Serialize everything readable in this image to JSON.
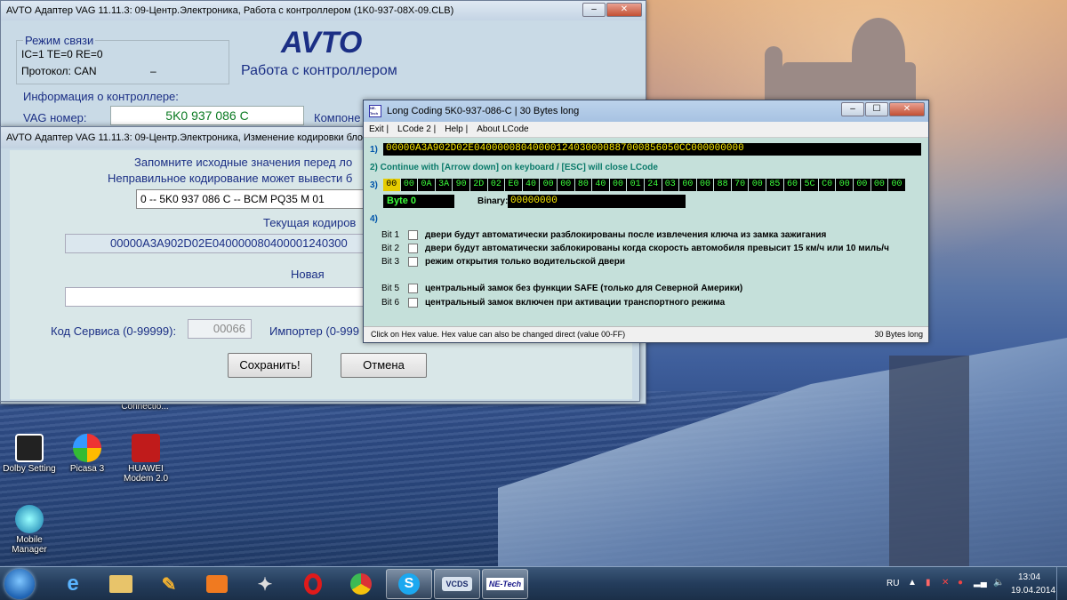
{
  "main_window": {
    "title": "AVTO Адаптер VAG 11.11.3: 09-Центр.Электроника,  Работа с контроллером (1K0-937-08X-09.CLB)",
    "comm_mode_label": "Режим связи",
    "comm_values": "IC=1  TE=0   RE=0",
    "protocol": "Протокол: CAN",
    "protocol_dash": "–",
    "logo": "AVTO",
    "subtitle": "Работа с контроллером",
    "controller_info_label": "Информация о контроллере:",
    "vag_label": "VAG номер:",
    "vag_value": "5K0 937 086 C",
    "component_label": "Компоне"
  },
  "coding_window": {
    "title": "AVTO Адаптер VAG 11.11.3: 09-Центр.Электроника,  Изменение кодировки блока",
    "warning_line1": "Запомните исходные значения перед ло",
    "warning_line2": "Неправильное кодирование может вывести б",
    "dropdown_value": "0 -- 5K0 937 086 C -- BCM PQ35 M    01",
    "current_label": "Текущая кодиров",
    "current_value": "00000A3A902D02E040000080400001240300",
    "new_label": "Новая",
    "new_value": "",
    "service_label": "Код Сервиса (0-99999):",
    "service_value": "00066",
    "importer_label": "Импортер (0-999",
    "save_button": "Сохранить!",
    "cancel_button": "Отмена"
  },
  "long_coding": {
    "title": "Long Coding  5K0-937-086-C | 30 Bytes long",
    "app_icon": "NE-Tech",
    "menu": [
      "Exit |",
      "LCode 2 |",
      "Help |",
      "About LCode"
    ],
    "step1": "1)",
    "coding_string": "00000A3A902D02E04000008040000124030000887000856050CC000000000",
    "step2": "2) Continue with [Arrow down] on keyboard / [ESC] will close LCode",
    "step3": "3)",
    "bytes": [
      "00",
      "00",
      "0A",
      "3A",
      "90",
      "2D",
      "02",
      "E0",
      "40",
      "00",
      "00",
      "80",
      "40",
      "00",
      "01",
      "24",
      "03",
      "00",
      "00",
      "88",
      "70",
      "00",
      "85",
      "60",
      "5C",
      "C0",
      "00",
      "00",
      "00",
      "00"
    ],
    "selected_byte_index": 0,
    "byte_label": "Byte 0",
    "binary_label": "Binary:",
    "binary_value": "00000000",
    "step4": "4)",
    "bits": [
      {
        "label": "Bit 1",
        "text": "двери будут автоматически разблокированы после извлечения ключа из замка зажигания",
        "checked": false
      },
      {
        "label": "Bit 2",
        "text": "двери будут автоматически заблокированы когда скорость автомобиля превысит 15 км/ч или 10 миль/ч",
        "checked": false
      },
      {
        "label": "Bit 3",
        "text": "режим открытия только водительской двери",
        "checked": false
      },
      {
        "label": "Bit 5",
        "text": "центральный замок без функции SAFE (только для Северной Америки)",
        "checked": false
      },
      {
        "label": "Bit 6",
        "text": "центральный замок включен при активации транспортного режима",
        "checked": false
      }
    ],
    "status_left": "Click on Hex value. Hex value can also be changed direct (value 00-FF)",
    "status_right": "30 Bytes long"
  },
  "desktop_icons": [
    {
      "label": "Connectio...",
      "icon": "network-icon"
    },
    {
      "label": "Dolby Setting",
      "icon": "dolby-icon"
    },
    {
      "label": "Picasa 3",
      "icon": "picasa-icon"
    },
    {
      "label": "HUAWEI Modem 2.0",
      "icon": "huawei-icon"
    },
    {
      "label": "Mobile Manager",
      "icon": "mobile-manager-icon"
    }
  ],
  "taskbar": {
    "apps": [
      "ie-icon",
      "explorer-icon",
      "tools-icon",
      "media-player-icon",
      "paint-icon",
      "opera-icon",
      "chrome-icon",
      "skype-icon",
      "vcds-icon",
      "netech-icon"
    ],
    "vcds_label": "VCDS",
    "netech_label": "NE-Tech",
    "lang": "RU",
    "time": "13:04",
    "date": "19.04.2014"
  }
}
